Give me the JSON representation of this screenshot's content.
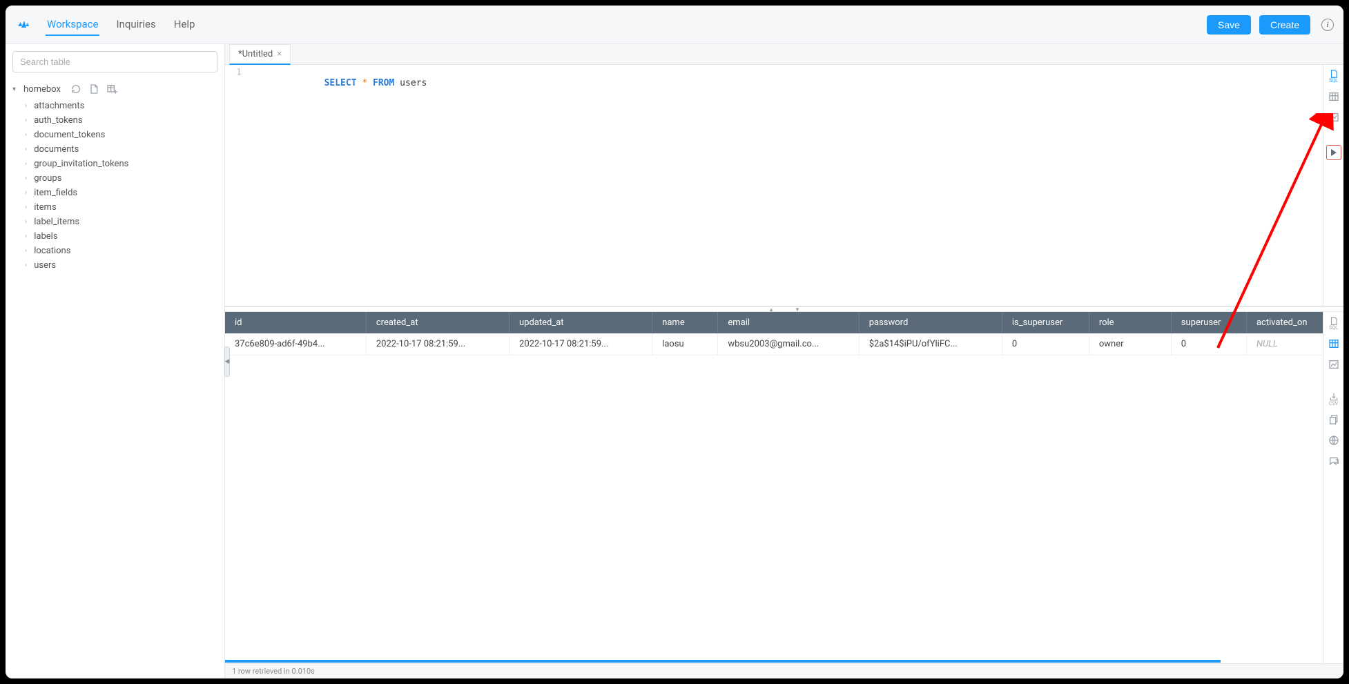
{
  "header": {
    "nav": {
      "workspace": "Workspace",
      "inquiries": "Inquiries",
      "help": "Help"
    },
    "save_label": "Save",
    "create_label": "Create"
  },
  "sidebar": {
    "search_placeholder": "Search table",
    "database": "homebox",
    "tables": [
      "attachments",
      "auth_tokens",
      "document_tokens",
      "documents",
      "group_invitation_tokens",
      "groups",
      "item_fields",
      "items",
      "label_items",
      "labels",
      "locations",
      "users"
    ]
  },
  "tab": {
    "title": "*Untitled"
  },
  "query": {
    "line_no": "1",
    "kw_select": "SELECT",
    "star": "*",
    "kw_from": "FROM",
    "ident": "users"
  },
  "results": {
    "columns": [
      "id",
      "created_at",
      "updated_at",
      "name",
      "email",
      "password",
      "is_superuser",
      "role",
      "superuser",
      "activated_on"
    ],
    "rows": [
      {
        "id": "37c6e809-ad6f-49b4...",
        "created_at": "2022-10-17 08:21:59...",
        "updated_at": "2022-10-17 08:21:59...",
        "name": "laosu",
        "email": "wbsu2003@gmail.co...",
        "password": "$2a$14$iPU/ofYliFC...",
        "is_superuser": "0",
        "role": "owner",
        "superuser": "0",
        "activated_on": "NULL"
      }
    ]
  },
  "status": "1 row retrieved in 0.010s",
  "col_widths": [
    "146px",
    "148px",
    "148px",
    "68px",
    "146px",
    "148px",
    "90px",
    "85px",
    "78px",
    "100px"
  ]
}
